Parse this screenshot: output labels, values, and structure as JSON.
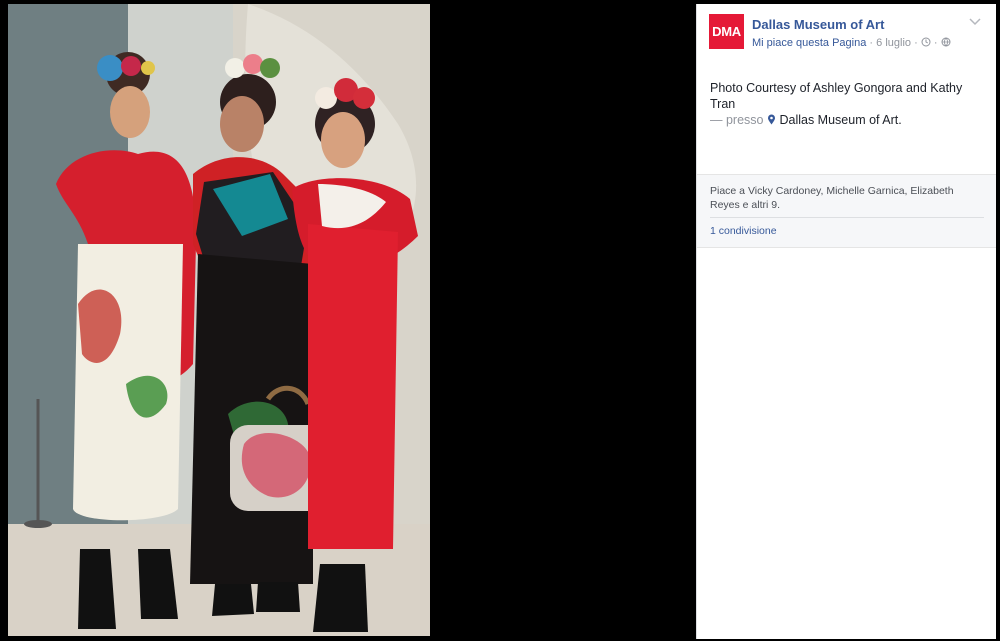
{
  "page": {
    "logo_text": "DMA",
    "name": "Dallas Museum of Art",
    "like_label": "Mi piace questa Pagina",
    "date": "6 luglio",
    "separator": " · "
  },
  "post": {
    "text": "Photo Courtesy of Ashley Gongora and Kathy Tran",
    "at_prefix": "— presso",
    "location": "Dallas Museum of Art."
  },
  "reactions": {
    "likes_text": "Piace a Vicky Cardoney, Michelle Garnica, Elizabeth Reyes e altri 9.",
    "shares_text": "1 condivisione"
  },
  "icons": {
    "chevron": "chevron-down-icon",
    "clock": "clock-icon",
    "globe": "globe-icon",
    "location": "location-pin-icon"
  },
  "colors": {
    "brand_red": "#e51937",
    "link_blue": "#365899",
    "meta_gray": "#90949c"
  }
}
